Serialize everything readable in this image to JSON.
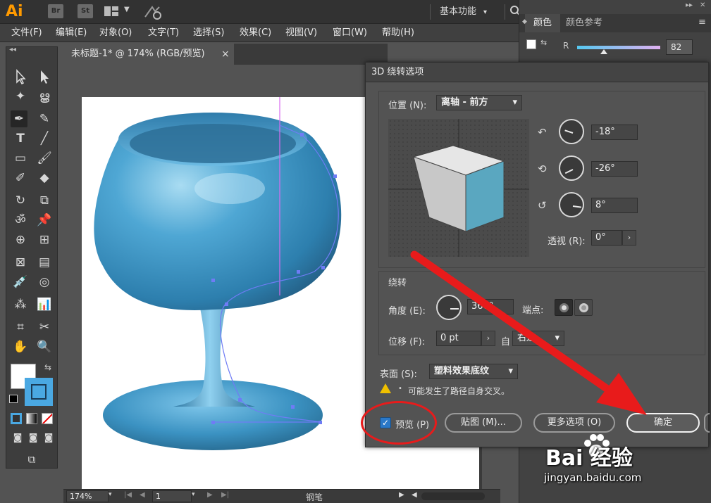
{
  "app": {
    "logo": "Ai",
    "bridge_label": "Br",
    "stock_label": "St",
    "workspace": "基本功能"
  },
  "menu": [
    "文件(F)",
    "编辑(E)",
    "对象(O)",
    "文字(T)",
    "选择(S)",
    "效果(C)",
    "视图(V)",
    "窗口(W)",
    "帮助(H)"
  ],
  "document": {
    "tab_title": "未标题-1* @ 174% (RGB/预览)",
    "close_glyph": "×"
  },
  "status": {
    "zoom": "174%",
    "page": "1",
    "tool": "钢笔"
  },
  "color_panel": {
    "tab_color": "颜色",
    "tab_guide": "颜色参考",
    "r_label": "R",
    "r_value": "82",
    "r_fraction": 0.32
  },
  "dialog": {
    "title": "3D 绕转选项",
    "position_label": "位置 (N):",
    "position_value": "离轴 - 前方",
    "rot_x": "-18°",
    "rot_y": "-26°",
    "rot_z": "8°",
    "perspective_label": "透视 (R):",
    "perspective_value": "0°",
    "revolve_label": "绕转",
    "angle_label": "角度 (E):",
    "angle_value": "360°",
    "cap_label": "端点:",
    "offset_label": "位移 (F):",
    "offset_value": "0 pt",
    "from_label": "自",
    "from_value": "右边",
    "surface_label": "表面 (S):",
    "surface_value": "塑料效果底纹",
    "warning": "可能发生了路径自身交叉。",
    "preview_label": "预览 (P)",
    "preview_checked": true,
    "map_button": "贴图 (M)...",
    "more_button": "更多选项 (O)",
    "ok_button": "确定"
  },
  "watermark": {
    "text": "Bai 经验",
    "url": "jingyan.baidu.com"
  },
  "colors": {
    "goblet": "#3f8fbd",
    "accent_red": "#e81b1b",
    "cube_face": "#5aa7c0"
  }
}
